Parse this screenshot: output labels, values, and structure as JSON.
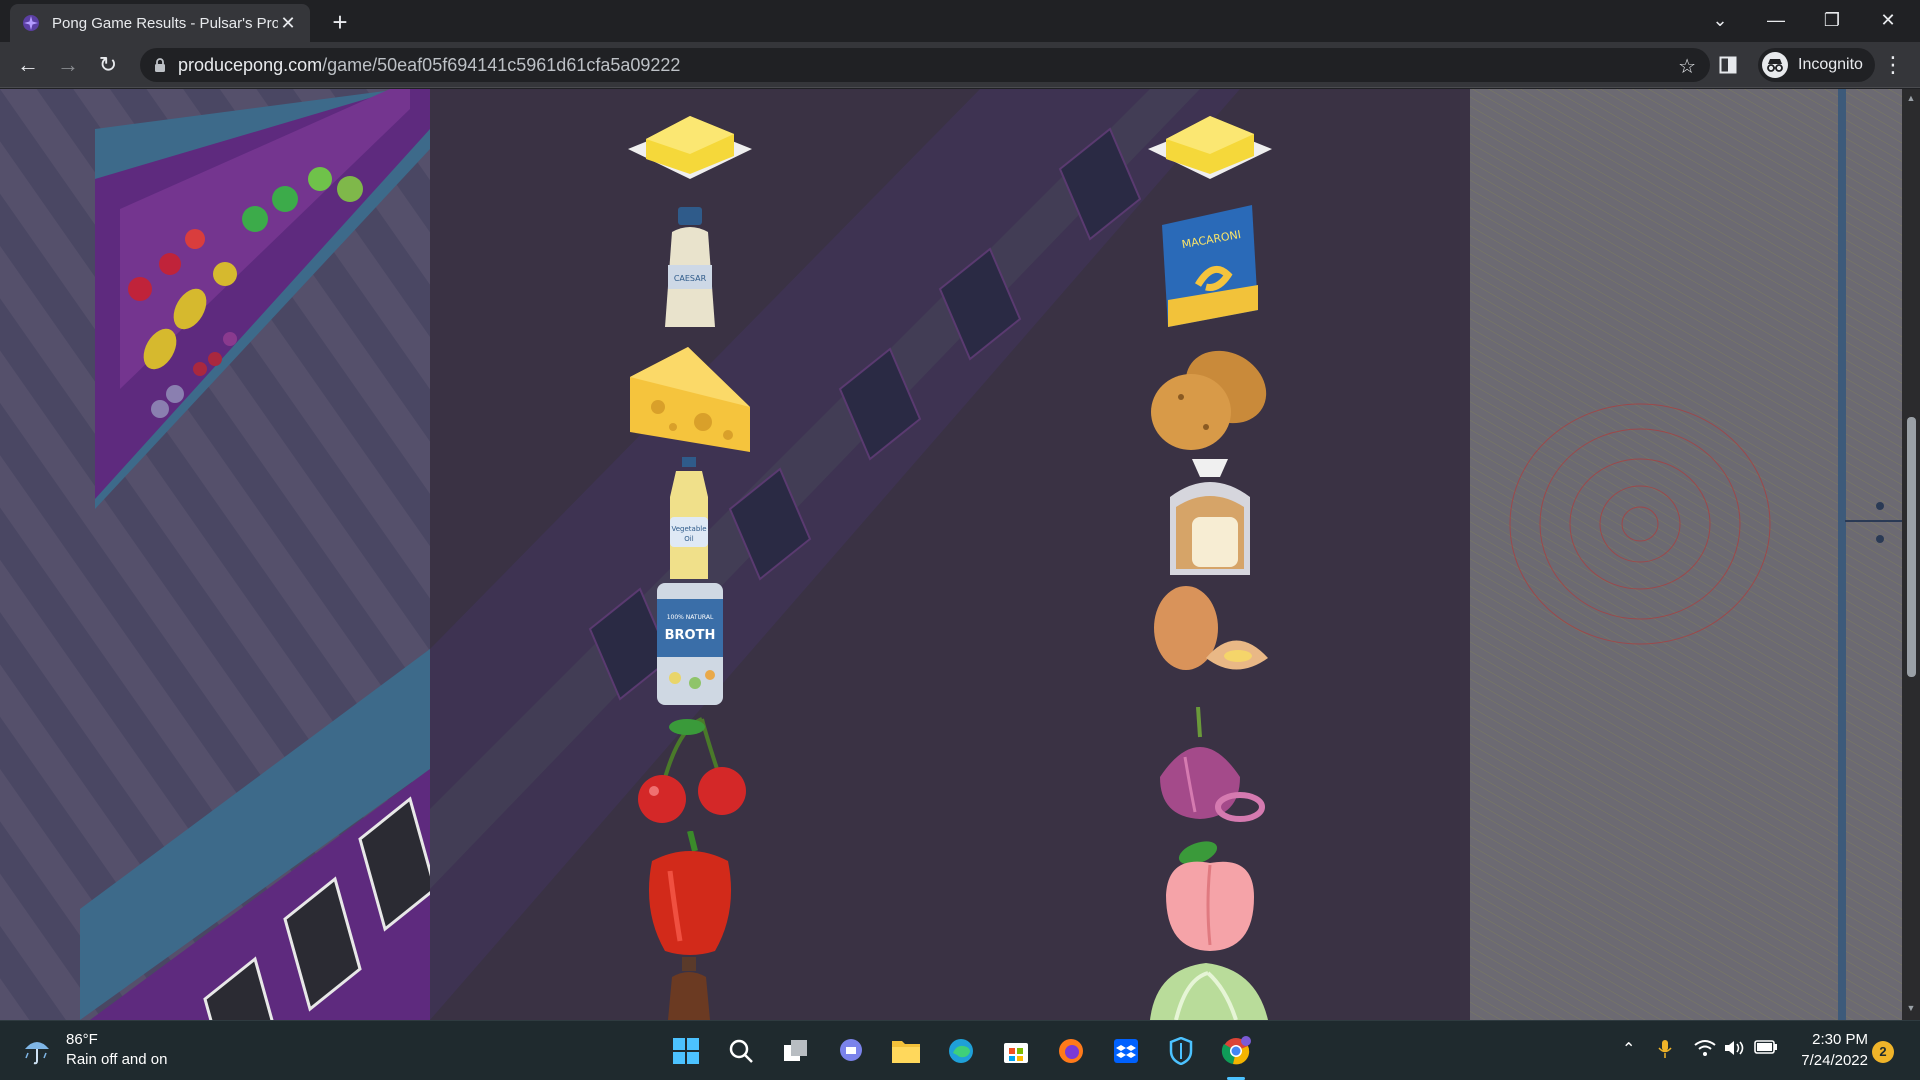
{
  "tab": {
    "title": "Pong Game Results - Pulsar's Pro",
    "close_glyph": "✕",
    "new_tab_glyph": "+"
  },
  "window_controls": {
    "dropdown_glyph": "⌄",
    "minimize_glyph": "—",
    "restore_glyph": "❐",
    "close_glyph": "✕"
  },
  "toolbar": {
    "back_glyph": "←",
    "forward_glyph": "→",
    "reload_glyph": "↻",
    "url_host": "producepong.com",
    "url_path": "/game/50eaf05f694141c5961d61cfa5a09222",
    "star_glyph": "☆",
    "incognito_label": "Incognito",
    "menu_glyph": "⋮"
  },
  "left_column_items": [
    "butter-icon",
    "caesar-dressing-icon",
    "cheese-icon",
    "vegetable-oil-icon",
    "broth-can-icon",
    "cherries-icon",
    "bell-pepper-icon",
    "sauce-bottle-icon"
  ],
  "right_column_items": [
    "butter-icon",
    "macaroni-box-icon",
    "potatoes-icon",
    "bread-loaf-icon",
    "eggs-icon",
    "red-onion-icon",
    "peach-icon",
    "lettuce-icon"
  ],
  "labels": {
    "caesar": "CAESAR",
    "veg_oil_1": "Vegetable",
    "veg_oil_2": "Oil",
    "broth_small": "100% NATURAL",
    "broth": "BROTH",
    "macaroni": "MACARONI"
  },
  "taskbar": {
    "weather_temp": "86°F",
    "weather_desc": "Rain off and on",
    "time": "2:30 PM",
    "date": "7/24/2022",
    "notification_count": "2"
  },
  "colors": {
    "page_bg": "#4a3f5c",
    "center_panel": "#3a3244",
    "right_panel": "#6e6a72",
    "shelf_purple": "#6a2f8a",
    "shelf_blue": "#3d6a8a",
    "chrome_dark": "#202124",
    "chrome_toolbar": "#35363a",
    "taskbar": "#1f2a2e"
  }
}
